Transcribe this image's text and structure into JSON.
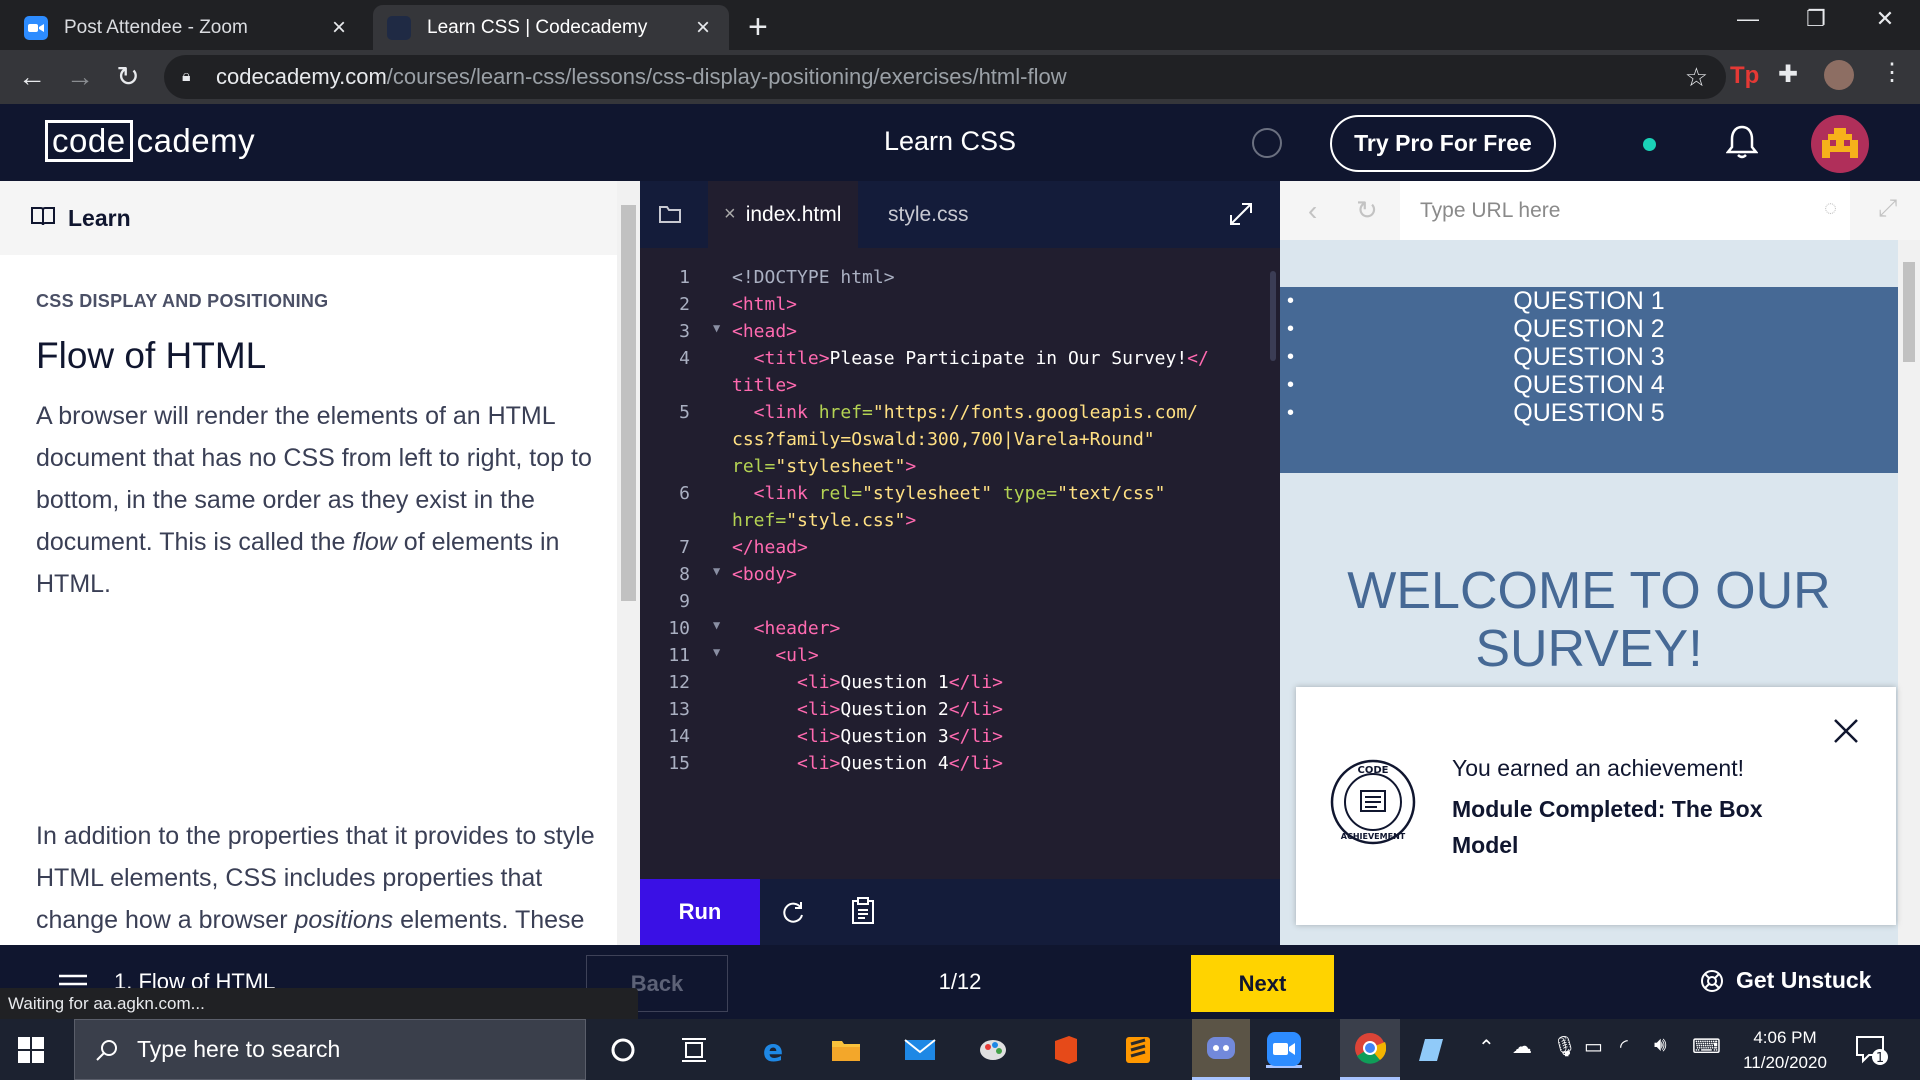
{
  "browser": {
    "tabs": [
      {
        "title": "Post Attendee - Zoom",
        "active": false
      },
      {
        "title": "Learn CSS | Codecademy",
        "active": true
      }
    ],
    "url_host": "codecademy.com",
    "url_path": "/courses/learn-css/lessons/css-display-positioning/exercises/html-flow"
  },
  "header": {
    "logo_code": "code",
    "logo_rest": "cademy",
    "course_title": "Learn CSS",
    "try_pro_label": "Try Pro For Free"
  },
  "learn": {
    "heading": "Learn",
    "category": "CSS DISPLAY AND POSITIONING",
    "title": "Flow of HTML",
    "para1_a": "A browser will render the elements of an HTML document that has no CSS from left to right, top to bottom, in the same order as they exist in the document. This is called the ",
    "para1_em": "flow",
    "para1_b": " of elements in HTML.",
    "para2_a": "In addition to the properties that it provides to style HTML elements, CSS includes properties that change how a browser ",
    "para2_em": "positions",
    "para2_b": " elements. These properties specify where an element is located on a page, if the element can share lines with other elements, and other related attributes."
  },
  "editor": {
    "tab_active": "index.html",
    "tab_other": "style.css",
    "run_label": "Run",
    "lines": [
      {
        "n": "1",
        "fold": false,
        "segments": [
          [
            "doc",
            "<!DOCTYPE html>"
          ]
        ]
      },
      {
        "n": "2",
        "fold": false,
        "segments": [
          [
            "tag",
            "<html>"
          ]
        ]
      },
      {
        "n": "3",
        "fold": true,
        "segments": [
          [
            "tag",
            "<head>"
          ]
        ]
      },
      {
        "n": "4",
        "fold": false,
        "segments": [
          [
            "tag",
            "  <title>"
          ],
          [
            "txt",
            "Please Participate in Our Survey!"
          ],
          [
            "tag",
            "</"
          ]
        ]
      },
      {
        "n": "",
        "fold": false,
        "segments": [
          [
            "tag",
            "title>"
          ]
        ]
      },
      {
        "n": "5",
        "fold": false,
        "segments": [
          [
            "tag",
            "  <link "
          ],
          [
            "attr",
            "href="
          ],
          [
            "str",
            "\"https://fonts.googleapis.com/"
          ]
        ]
      },
      {
        "n": "",
        "fold": false,
        "segments": [
          [
            "str",
            "css?family=Oswald:300,700|Varela+Round\""
          ]
        ]
      },
      {
        "n": "",
        "fold": false,
        "segments": [
          [
            "attr",
            "rel="
          ],
          [
            "str",
            "\"stylesheet\""
          ],
          [
            "tag",
            ">"
          ]
        ]
      },
      {
        "n": "6",
        "fold": false,
        "segments": [
          [
            "tag",
            "  <link "
          ],
          [
            "attr",
            "rel="
          ],
          [
            "str",
            "\"stylesheet\" "
          ],
          [
            "attr",
            "type="
          ],
          [
            "str",
            "\"text/css\""
          ]
        ]
      },
      {
        "n": "",
        "fold": false,
        "segments": [
          [
            "attr",
            "href="
          ],
          [
            "str",
            "\"style.css\""
          ],
          [
            "tag",
            ">"
          ]
        ]
      },
      {
        "n": "7",
        "fold": false,
        "segments": [
          [
            "tag",
            "</head>"
          ]
        ]
      },
      {
        "n": "8",
        "fold": true,
        "segments": [
          [
            "tag",
            "<body>"
          ]
        ]
      },
      {
        "n": "9",
        "fold": false,
        "segments": []
      },
      {
        "n": "10",
        "fold": true,
        "segments": [
          [
            "tag",
            "  <header>"
          ]
        ]
      },
      {
        "n": "11",
        "fold": true,
        "segments": [
          [
            "tag",
            "    <ul>"
          ]
        ]
      },
      {
        "n": "12",
        "fold": false,
        "segments": [
          [
            "tag",
            "      <li>"
          ],
          [
            "txt",
            "Question 1"
          ],
          [
            "tag",
            "</li>"
          ]
        ]
      },
      {
        "n": "13",
        "fold": false,
        "segments": [
          [
            "tag",
            "      <li>"
          ],
          [
            "txt",
            "Question 2"
          ],
          [
            "tag",
            "</li>"
          ]
        ]
      },
      {
        "n": "14",
        "fold": false,
        "segments": [
          [
            "tag",
            "      <li>"
          ],
          [
            "txt",
            "Question 3"
          ],
          [
            "tag",
            "</li>"
          ]
        ]
      },
      {
        "n": "15",
        "fold": false,
        "segments": [
          [
            "tag",
            "      <li>"
          ],
          [
            "txt",
            "Question 4"
          ],
          [
            "tag",
            "</li>"
          ]
        ]
      }
    ]
  },
  "preview": {
    "url_placeholder": "Type URL here",
    "questions": [
      "QUESTION 1",
      "QUESTION 2",
      "QUESTION 3",
      "QUESTION 4",
      "QUESTION 5"
    ],
    "welcome_line1": "WELCOME TO OUR",
    "welcome_line2": "SURVEY!"
  },
  "achievement": {
    "line1": "You earned an achievement!",
    "line2": "Module Completed: The Box Model",
    "badge_top": "CODE",
    "badge_bottom": "ACHIEVEMENT"
  },
  "footer": {
    "lesson_label": "1. Flow of HTML",
    "back_label": "Back",
    "progress": "1/12",
    "next_label": "Next",
    "unstuck_label": "Get Unstuck"
  },
  "status_text": "Waiting for aa.agkn.com...",
  "taskbar": {
    "search_placeholder": "Type here to search",
    "time": "4:06 PM",
    "date": "11/20/2020",
    "notification_count": "1"
  },
  "colors": {
    "cc_navy": "#10162f",
    "run_purple": "#3a10e5",
    "next_yellow": "#ffd300",
    "survey_blue": "#466995"
  }
}
